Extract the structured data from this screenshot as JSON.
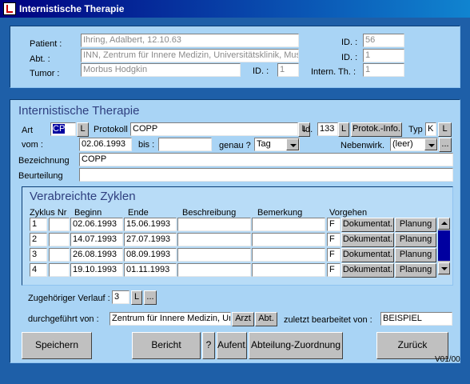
{
  "window": {
    "title": "Internistische Therapie",
    "icon": "app-icon"
  },
  "header": {
    "patient_label": "Patient :",
    "patient_value": "Ihring, Adalbert, 12.10.63",
    "patient_id_label": "ID. :",
    "patient_id": "56",
    "abt_label": "Abt. :",
    "abt_value": "INN, Zentrum für Innere Medizin, Universitätsklinik, Muste",
    "abt_id_label": "ID. :",
    "abt_id": "1",
    "tumor_label": "Tumor :",
    "tumor_value": "Morbus Hodgkin",
    "tumor_id_label": "ID. :",
    "tumor_id": "1",
    "intern_label": "Intern. Th. :",
    "intern_value": "1"
  },
  "form": {
    "section_title": "Internistische Therapie",
    "art_label": "Art",
    "art_value": "CP",
    "l_label": "L",
    "protokoll_label": "Protokoll",
    "protokoll_value": "COPP",
    "id_label": "Id.",
    "id_value": "133",
    "protok_info_label": "Protok.-Info.",
    "typ_label": "Typ",
    "typ_value": "K",
    "vom_label": "vom :",
    "vom_value": "02.06.1993",
    "bis_label": "bis :",
    "bis_value": "",
    "genau_label": "genau ?",
    "genau_value": "Tag",
    "nebenwirk_label": "Nebenwirk.",
    "nebenwirk_value": "(leer)",
    "ellipsis_label": "...",
    "bezeichnung_label": "Bezeichnung",
    "bezeichnung_value": "COPP",
    "beurteilung_label": "Beurteilung",
    "beurteilung_value": ""
  },
  "zyklen": {
    "title": "Verabreichte Zyklen",
    "headers": [
      "Zyklus Nr",
      "Beginn",
      "Ende",
      "Beschreibung",
      "Bemerkung",
      "Vorgehen"
    ],
    "rows": [
      {
        "nr": "1",
        "beginn": "02.06.1993",
        "ende": "15.06.1993",
        "vorgehen": "F",
        "dok": "Dokumentat.",
        "plan": "Planung"
      },
      {
        "nr": "2",
        "beginn": "14.07.1993",
        "ende": "27.07.1993",
        "vorgehen": "F",
        "dok": "Dokumentat.",
        "plan": "Planung"
      },
      {
        "nr": "3",
        "beginn": "26.08.1993",
        "ende": "08.09.1993",
        "vorgehen": "F",
        "dok": "Dokumentat.",
        "plan": "Planung"
      },
      {
        "nr": "4",
        "beginn": "19.10.1993",
        "ende": "01.11.1993",
        "vorgehen": "F",
        "dok": "Dokumentat.",
        "plan": "Planung"
      }
    ]
  },
  "verlauf": {
    "label": "Zugehöriger Verlauf :",
    "value": "3",
    "l_label": "L",
    "ellipsis_label": "..."
  },
  "durchgefuehrt": {
    "label": "durchgeführt von :",
    "value": "Zentrum für Innere Medizin, Ur",
    "arzt_label": "Arzt",
    "abt_label": "Abt.",
    "zuletzt_label": "zuletzt bearbeitet von :",
    "zuletzt_value": "BEISPIEL"
  },
  "buttons": {
    "speichern": "Speichern",
    "bericht": "Bericht",
    "help": "?",
    "aufent": "Aufent.",
    "abteilung": "Abteilung-Zuordnung",
    "zurueck": "Zurück"
  },
  "version": "V01/00"
}
